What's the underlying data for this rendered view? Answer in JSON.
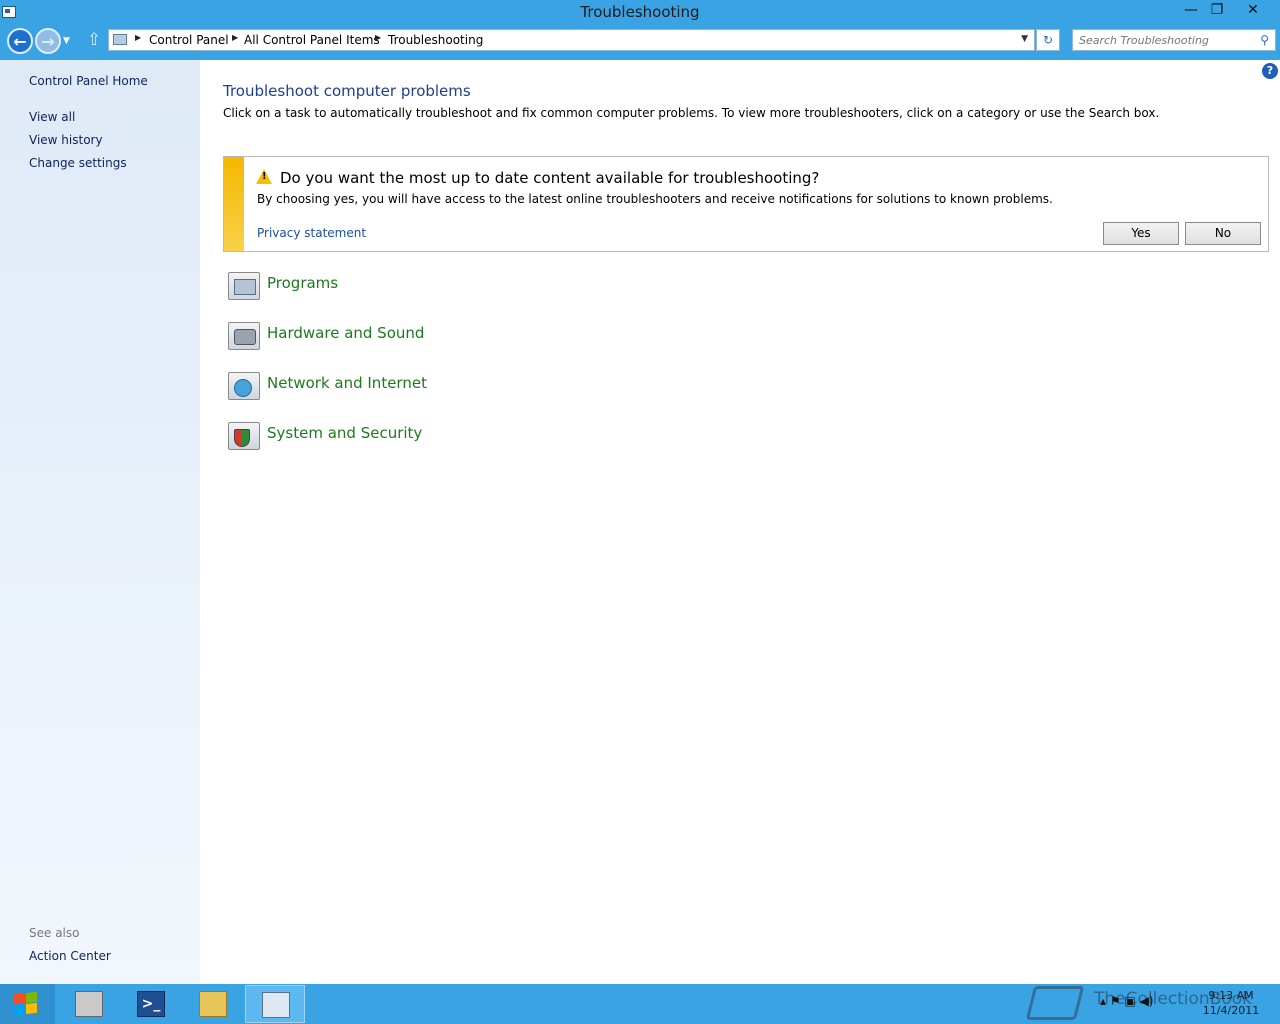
{
  "window": {
    "title": "Troubleshooting",
    "minimize": "—",
    "maximize": "❐",
    "close": "✕"
  },
  "nav": {
    "back_icon": "←",
    "forward_icon": "→",
    "dropdown_icon": "▼",
    "up_icon": "⇧",
    "breadcrumb": [
      "Control Panel",
      "All Control Panel Items",
      "Troubleshooting"
    ],
    "refresh_icon": "↻",
    "search_placeholder": "Search Troubleshooting",
    "search_icon": "⚲"
  },
  "sidebar": {
    "home": "Control Panel Home",
    "links": [
      "View all",
      "View history",
      "Change settings"
    ],
    "see_also_label": "See also",
    "see_also_links": [
      "Action Center"
    ]
  },
  "main": {
    "help_icon": "?",
    "title": "Troubleshoot computer problems",
    "description": "Click on a task to automatically troubleshoot and fix common computer problems. To view more troubleshooters, click on a category or use the Search box.",
    "infobar": {
      "question": "Do you want the most up to date content available for troubleshooting?",
      "detail": "By choosing yes, you will have access to the latest online troubleshooters and receive notifications for solutions to known problems.",
      "privacy_link": "Privacy statement",
      "yes_label": "Yes",
      "no_label": "No",
      "accent_color": "#f5b800"
    },
    "categories": [
      {
        "label": "Programs",
        "icon": "programs-icon"
      },
      {
        "label": "Hardware and Sound",
        "icon": "hardware-sound-icon"
      },
      {
        "label": "Network and Internet",
        "icon": "network-internet-icon"
      },
      {
        "label": "System and Security",
        "icon": "system-security-icon"
      }
    ],
    "category_color": "#1e7a1e"
  },
  "taskbar": {
    "apps": [
      "server-manager-icon",
      "powershell-icon",
      "file-explorer-icon",
      "control-panel-icon"
    ],
    "powershell_glyph": ">_",
    "tray_icons": "▴ ⚑ ▣ ◀)",
    "time": "9:13 AM",
    "date": "11/4/2011",
    "watermark": "TheCollectionBook"
  },
  "colors": {
    "titlebar": "#3aa3e3",
    "sidebar": "#dfeaf7",
    "link": "#10215b",
    "heading": "#1d3f8f"
  }
}
